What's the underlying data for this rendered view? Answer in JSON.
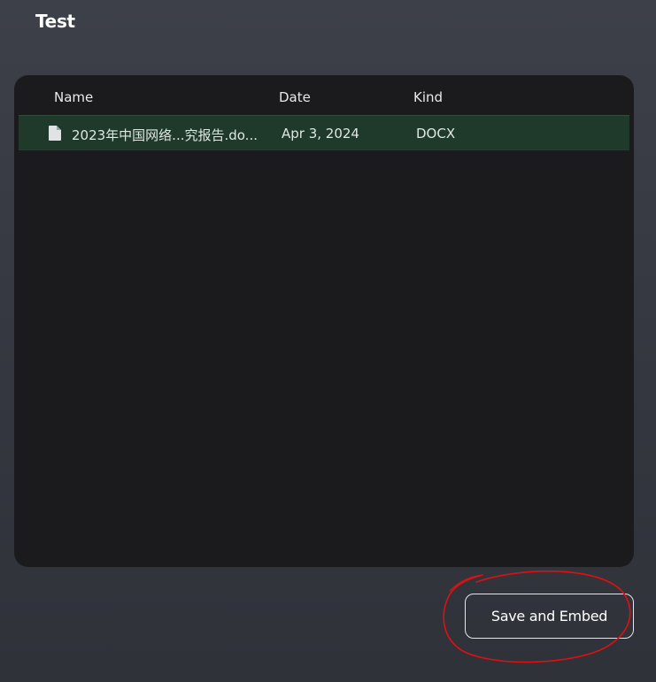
{
  "workspace": {
    "title": "Test"
  },
  "file_table": {
    "columns": {
      "name": "Name",
      "date": "Date",
      "kind": "Kind"
    },
    "rows": [
      {
        "icon": "document-icon",
        "name": "2023年中国网络...究报告.do...",
        "date": "Apr 3, 2024",
        "kind": "DOCX",
        "selected": true
      }
    ]
  },
  "actions": {
    "save_label": "Save and Embed"
  },
  "colors": {
    "background": "#3a3d46",
    "panel": "#1b1b1d",
    "selected_row": "#1f3a2a",
    "annotation": "#e01010"
  }
}
